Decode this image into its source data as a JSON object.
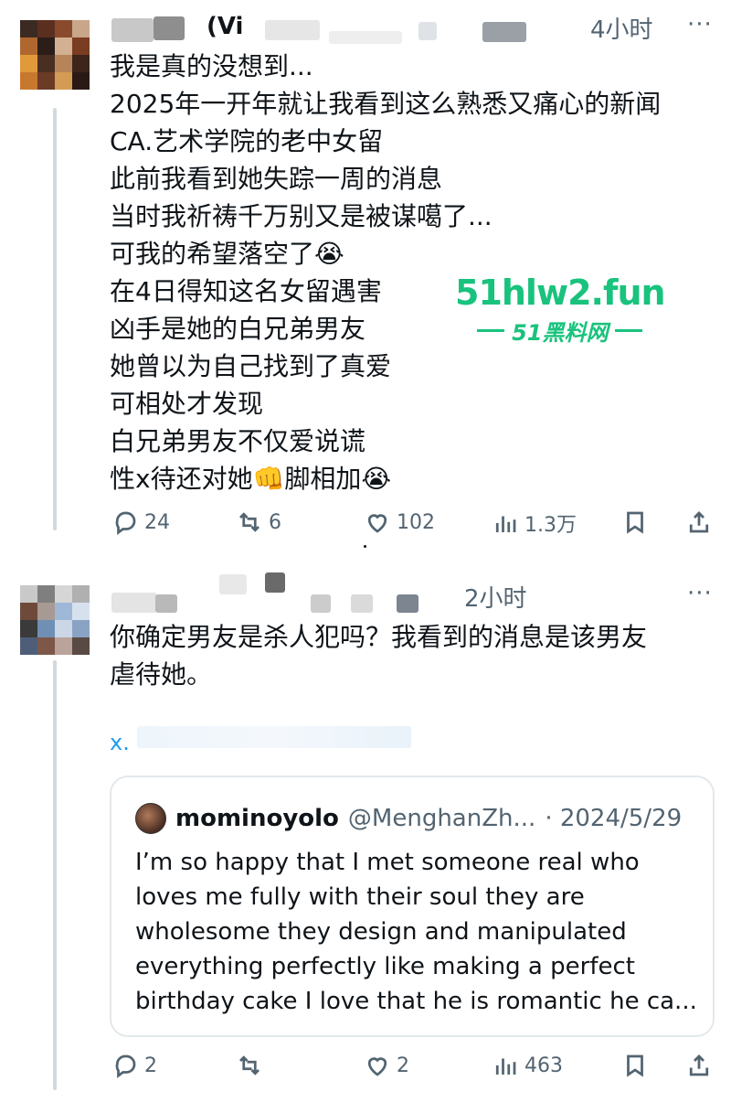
{
  "colors": {
    "text": "#0f1419",
    "muted": "#536471",
    "link": "#1d9bf0",
    "watermark": "#19c37d",
    "border": "#e3e8eb"
  },
  "tweet1": {
    "name_partial": "(Vi",
    "time": "4小时",
    "more": "···",
    "body": "我是真的没想到...\n2025年一开年就让我看到这么熟悉又痛心的新闻\nCA.艺术学院的老中女留\n此前我看到她失踪一周的消息\n当时我祈祷千万别又是被谋噶了...\n可我的希望落空了😭\n在4日得知这名女留遇害\n凶手是她的白兄弟男友\n她曾以为自己找到了真爱\n可相处才发现\n白兄弟男友不仅爱说谎\n性x待还对她👊脚相加😭",
    "actions": {
      "replies": "24",
      "retweets": "6",
      "likes": "102",
      "views": "1.3万"
    }
  },
  "tweet2": {
    "time": "2小时",
    "more": "···",
    "body": "你确定男友是杀人犯吗？我看到的消息是该男友\n虐待她。",
    "link_fragment": "x.",
    "quote": {
      "name": "mominoyolo",
      "handle": "@MenghanZh...",
      "date": "· 2024/5/29",
      "text": "I’m so happy that I met someone real who loves me fully with their soul they are wholesome they design and manipulated everything perfectly like making a perfect birthday cake I love that he is romantic he ca..."
    },
    "actions": {
      "replies": "2",
      "retweets": "",
      "likes": "2",
      "views": "463"
    }
  },
  "watermark": {
    "domain": "51hlw2.fun",
    "site": "51黑料网"
  },
  "icons": [
    "reply-icon",
    "retweet-icon",
    "like-icon",
    "views-icon",
    "bookmark-icon",
    "share-icon"
  ]
}
